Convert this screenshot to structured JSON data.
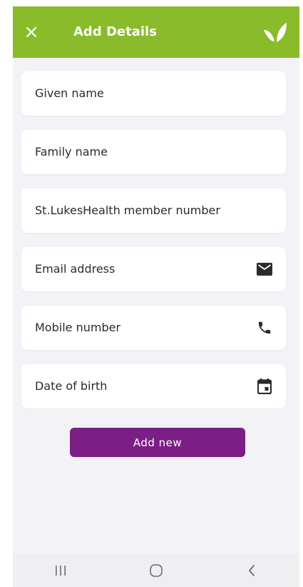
{
  "header": {
    "title": "Add Details",
    "background": "#8abb2a",
    "close_icon": "close-icon",
    "logo_icon": "leaf-logo-icon"
  },
  "form": {
    "fields": [
      {
        "label": "Given name",
        "icon": null
      },
      {
        "label": "Family name",
        "icon": null
      },
      {
        "label": "St.LukesHealth member number",
        "icon": null
      },
      {
        "label": "Email address",
        "icon": "mail-icon"
      },
      {
        "label": "Mobile number",
        "icon": "phone-icon"
      },
      {
        "label": "Date of birth",
        "icon": "calendar-icon"
      }
    ]
  },
  "actions": {
    "add_new_label": "Add new",
    "button_color": "#7b1f86"
  },
  "system_nav": {
    "recents_icon": "recents-icon",
    "home_icon": "home-icon",
    "back_icon": "back-icon"
  }
}
